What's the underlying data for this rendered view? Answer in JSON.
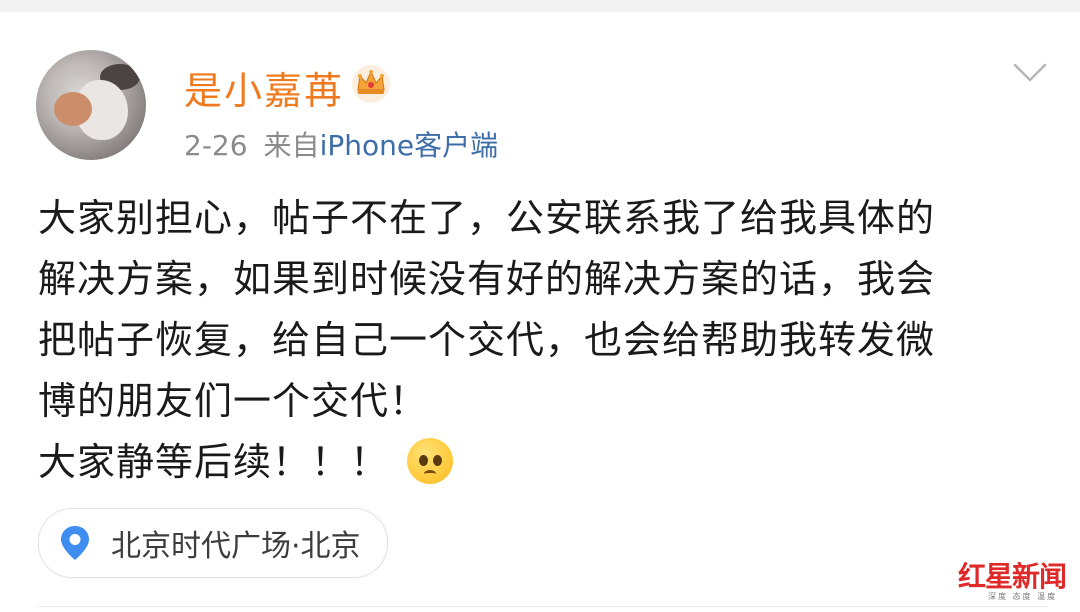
{
  "post": {
    "username": "是小嘉苒",
    "date": "2-26",
    "source_prefix": "来自",
    "source_app": "iPhone客户端",
    "content_lines": [
      "大家别担心，帖子不在了，公安联系我了给我具体的",
      "解决方案，如果到时候没有好的解决方案的话，我会",
      "把帖子恢复，给自己一个交代，也会给帮助我转发微",
      "博的朋友们一个交代！",
      " 大家静等后续！！！"
    ],
    "location": "北京时代广场·北京"
  },
  "watermark": {
    "name": "红星新闻",
    "tagline": "深度 态度 温度"
  },
  "icons": {
    "avatar": "user-avatar",
    "badge": "crown-badge-icon",
    "menu": "chevron-down-icon",
    "emoji": "pleading-face-emoji",
    "location": "location-pin-icon"
  },
  "colors": {
    "username": "#f07a1f",
    "link": "#3e6ea8",
    "meta": "#8b8b8b",
    "text": "#1a1a1a",
    "pin": "#3f8df0",
    "watermark": "#e02a2a"
  }
}
